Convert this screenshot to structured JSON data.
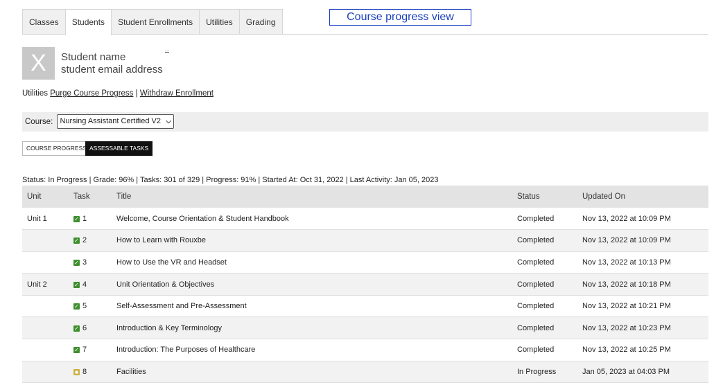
{
  "tabs": [
    "Classes",
    "Students",
    "Student Enrollments",
    "Utilities",
    "Grading"
  ],
  "active_tab": "Students",
  "view_label": "Course progress view",
  "student": {
    "avatar_letter": "X",
    "name": "Student name",
    "email": "student email address",
    "more_link": "···"
  },
  "utilities": {
    "label": "Utilities",
    "purge": "Purge Course Progress",
    "separator": "|",
    "withdraw": "Withdraw Enrollment"
  },
  "course": {
    "label": "Course:",
    "selected": "Nursing Assistant Certified V2"
  },
  "buttons": {
    "course_progress": "COURSE PROGRESS",
    "assessable_tasks": "ASSESSABLE TASKS"
  },
  "summary": "Status: In Progress | Grade: 96% | Tasks: 301 of 329 | Progress: 91% | Started At: Oct 31, 2022 | Last Activity: Jan 05, 2023",
  "table": {
    "headers": [
      "Unit",
      "Task",
      "Title",
      "Status",
      "Updated On"
    ],
    "rows": [
      {
        "unit": "Unit 1",
        "task": "1",
        "title": "Welcome, Course Orientation & Student Handbook",
        "status": "Completed",
        "updated": "Nov 13, 2022 at 10:09 PM",
        "done": true
      },
      {
        "unit": "",
        "task": "2",
        "title": "How to Learn with Rouxbe",
        "status": "Completed",
        "updated": "Nov 13, 2022 at 10:09 PM",
        "done": true
      },
      {
        "unit": "",
        "task": "3",
        "title": "How to Use the VR and Headset",
        "status": "Completed",
        "updated": "Nov 13, 2022 at 10:13 PM",
        "done": true
      },
      {
        "unit": "Unit 2",
        "task": "4",
        "title": "Unit Orientation & Objectives",
        "status": "Completed",
        "updated": "Nov 13, 2022 at 10:18 PM",
        "done": true
      },
      {
        "unit": "",
        "task": "5",
        "title": "Self-Assessment and Pre-Assessment",
        "status": "Completed",
        "updated": "Nov 13, 2022 at 10:21 PM",
        "done": true
      },
      {
        "unit": "",
        "task": "6",
        "title": "Introduction & Key Terminology",
        "status": "Completed",
        "updated": "Nov 13, 2022 at 10:23 PM",
        "done": true
      },
      {
        "unit": "",
        "task": "7",
        "title": "Introduction: The Purposes of Healthcare",
        "status": "Completed",
        "updated": "Nov 13, 2022 at 10:25 PM",
        "done": true
      },
      {
        "unit": "",
        "task": "8",
        "title": "Facilities",
        "status": "In Progress",
        "updated": "Jan 05, 2023 at 04:03 PM",
        "done": false
      }
    ]
  }
}
